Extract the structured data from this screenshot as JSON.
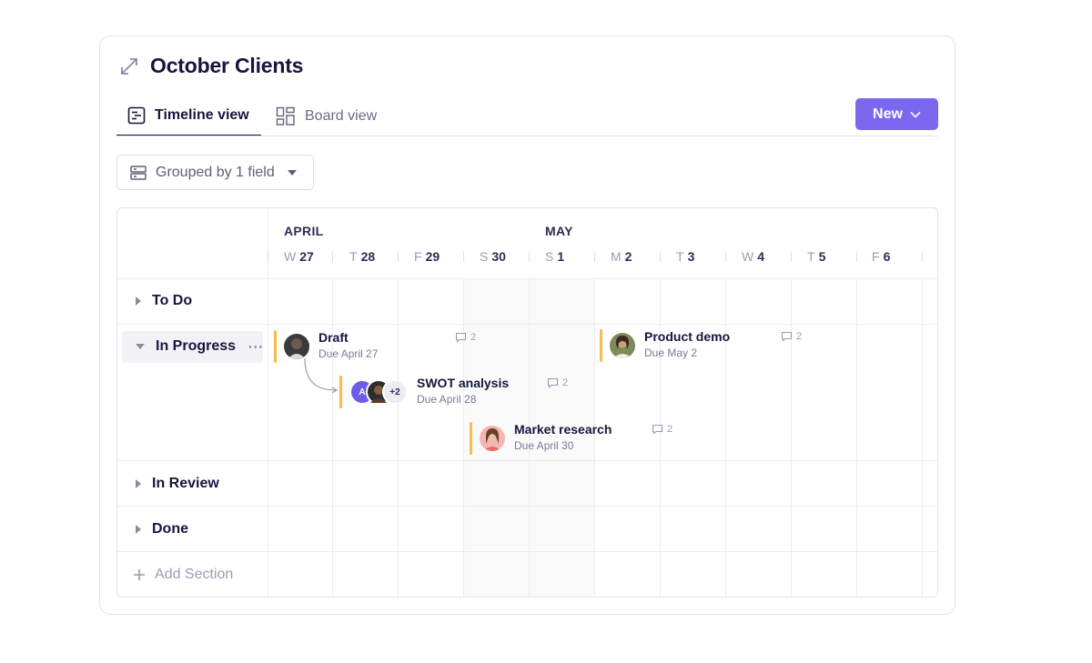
{
  "title": "October Clients",
  "tabs": [
    {
      "label": "Timeline view",
      "active": true
    },
    {
      "label": "Board view",
      "active": false
    }
  ],
  "new_button": {
    "label": "New"
  },
  "group_button": {
    "label": "Grouped by 1 field"
  },
  "timeline": {
    "months": [
      "APRIL",
      "MAY"
    ],
    "days": [
      {
        "dow": "W",
        "num": "27"
      },
      {
        "dow": "T",
        "num": "28"
      },
      {
        "dow": "F",
        "num": "29"
      },
      {
        "dow": "S",
        "num": "30"
      },
      {
        "dow": "S",
        "num": "1"
      },
      {
        "dow": "M",
        "num": "2"
      },
      {
        "dow": "T",
        "num": "3"
      },
      {
        "dow": "W",
        "num": "4"
      },
      {
        "dow": "T",
        "num": "5"
      },
      {
        "dow": "F",
        "num": "6"
      }
    ]
  },
  "sections": [
    {
      "label": "To Do",
      "expanded": false
    },
    {
      "label": "In Progress",
      "expanded": true,
      "more": "···"
    },
    {
      "label": "In Review",
      "expanded": false
    },
    {
      "label": "Done",
      "expanded": false
    }
  ],
  "add_section": {
    "label": "Add Section"
  },
  "tasks": [
    {
      "name": "Draft",
      "due": "Due April 27",
      "comments": "2"
    },
    {
      "name": "SWOT analysis",
      "due": "Due April 28",
      "comments": "2",
      "extra_assignees": "+2",
      "first_initial": "A"
    },
    {
      "name": "Market research",
      "due": "Due April 30",
      "comments": "2"
    },
    {
      "name": "Product demo",
      "due": "Due May 2",
      "comments": "2"
    }
  ],
  "colors": {
    "accent": "#7b68ee",
    "task_bar": "#f5c04a",
    "text": "#16163f"
  }
}
